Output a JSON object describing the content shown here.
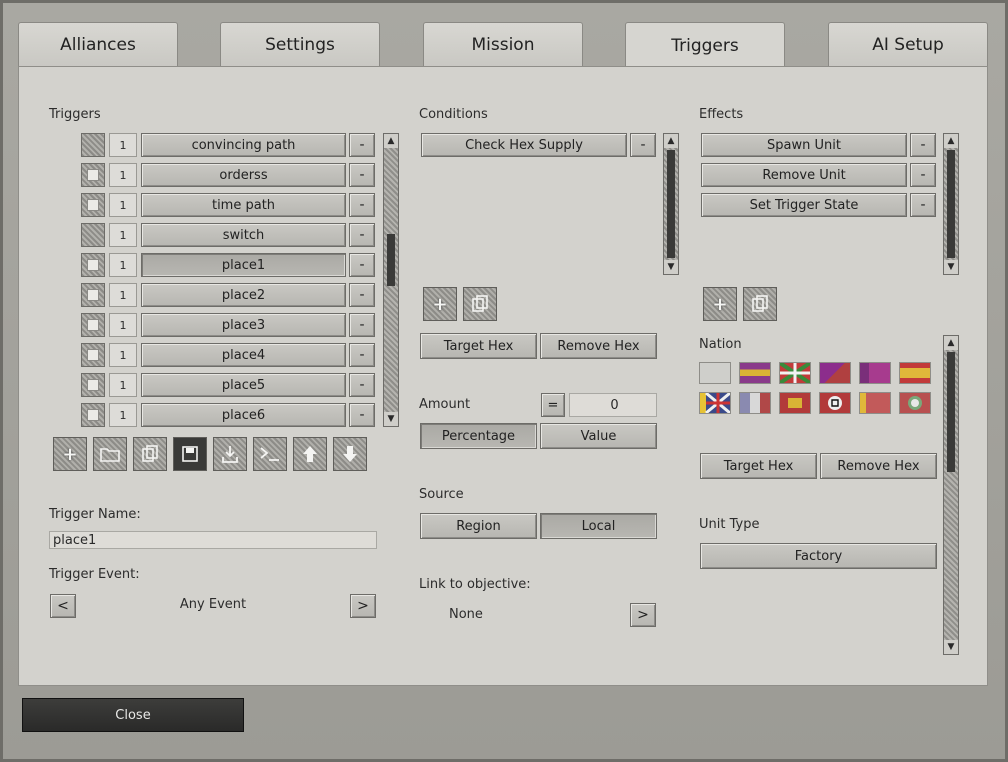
{
  "tabs": [
    {
      "label": "Alliances"
    },
    {
      "label": "Settings"
    },
    {
      "label": "Mission"
    },
    {
      "label": "Triggers"
    },
    {
      "label": "AI Setup"
    }
  ],
  "triggers": {
    "title": "Triggers",
    "rows": [
      {
        "count": "1",
        "name": "convincing path",
        "checked": false
      },
      {
        "count": "1",
        "name": "orderss",
        "checked": true
      },
      {
        "count": "1",
        "name": "time path",
        "checked": true
      },
      {
        "count": "1",
        "name": "switch",
        "checked": false
      },
      {
        "count": "1",
        "name": "place1",
        "checked": true
      },
      {
        "count": "1",
        "name": "place2",
        "checked": true
      },
      {
        "count": "1",
        "name": "place3",
        "checked": true
      },
      {
        "count": "1",
        "name": "place4",
        "checked": true
      },
      {
        "count": "1",
        "name": "place5",
        "checked": true
      },
      {
        "count": "1",
        "name": "place6",
        "checked": true
      }
    ],
    "remove_label": "-",
    "toolbar_icons": [
      "plus-icon",
      "folder-icon",
      "copy-icon",
      "save-icon",
      "import-icon",
      "console-icon",
      "arrow-up-icon",
      "arrow-down-icon"
    ],
    "trigger_name_label": "Trigger Name:",
    "trigger_name_value": "place1",
    "trigger_event_label": "Trigger Event:",
    "trigger_event_value": "Any Event",
    "prev_label": "<",
    "next_label": ">"
  },
  "conditions": {
    "title": "Conditions",
    "items": [
      {
        "name": "Check Hex Supply"
      }
    ],
    "remove_label": "-",
    "target_hex": "Target Hex",
    "remove_hex": "Remove Hex",
    "amount_label": "Amount",
    "amount_operator": "=",
    "amount_value": "0",
    "percentage": "Percentage",
    "value": "Value",
    "source_label": "Source",
    "region": "Region",
    "local": "Local",
    "link_label": "Link to objective:",
    "link_value": "None",
    "link_next": ">"
  },
  "effects": {
    "title": "Effects",
    "items": [
      {
        "name": "Spawn Unit"
      },
      {
        "name": "Remove Unit"
      },
      {
        "name": "Set Trigger State"
      }
    ],
    "remove_label": "-",
    "nation_label": "Nation",
    "target_hex": "Target Hex",
    "remove_hex": "Remove Hex",
    "unit_type_label": "Unit Type",
    "unit_type_value": "Factory"
  },
  "footer": {
    "close": "Close"
  }
}
